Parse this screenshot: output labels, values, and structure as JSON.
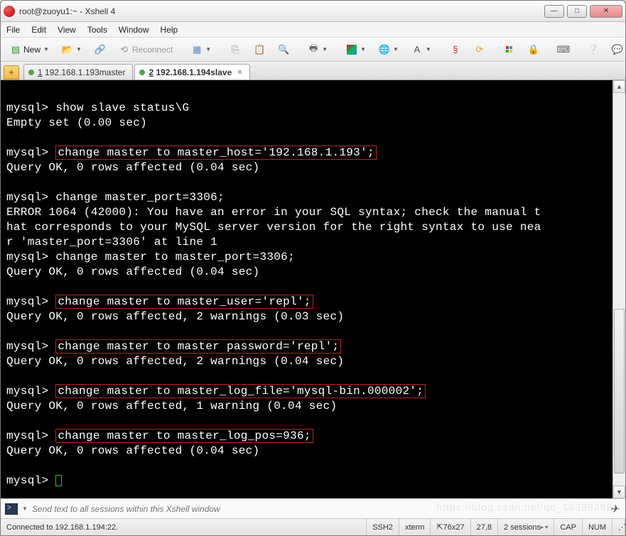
{
  "window": {
    "title": "root@zuoyu1:~ - Xshell 4"
  },
  "menu": {
    "file": "File",
    "edit": "Edit",
    "view": "View",
    "tools": "Tools",
    "window": "Window",
    "help": "Help"
  },
  "toolbar": {
    "new": "New",
    "reconnect": "Reconnect"
  },
  "tabs": {
    "t1": {
      "num": "1",
      "label": "192.168.1.193master"
    },
    "t2": {
      "num": "2",
      "label": "192.168.1.194slave"
    }
  },
  "terminal": {
    "p": "mysql> ",
    "l1": "show slave status\\G",
    "l2": "Empty set (0.00 sec)",
    "cmd_host": "change master to master_host='192.168.1.193';",
    "res_host": "Query OK, 0 rows affected (0.04 sec)",
    "cmd_port_bad": "change master_port=3306;",
    "err1": "ERROR 1064 (42000): You have an error in your SQL syntax; check the manual t",
    "err2": "hat corresponds to your MySQL server version for the right syntax to use nea",
    "err3": "r 'master_port=3306' at line 1",
    "cmd_port": "change master to master_port=3306;",
    "res_port": "Query OK, 0 rows affected (0.04 sec)",
    "cmd_user": "change master to master_user='repl';",
    "res_user": "Query OK, 0 rows affected, 2 warnings (0.03 sec)",
    "cmd_pass": "change master to master password='repl';",
    "res_pass": "Query OK, 0 rows affected, 2 warnings (0.04 sec)",
    "cmd_logf": "change master to master_log_file='mysql-bin.000002';",
    "res_logf": "Query OK, 0 rows affected, 1 warning (0.04 sec)",
    "cmd_logp": "change master to master_log_pos=936;",
    "res_logp": "Query OK, 0 rows affected (0.04 sec)"
  },
  "compose": {
    "placeholder": "Send text to all sessions within this Xshell window"
  },
  "status": {
    "conn": "Connected to 192.168.1.194:22.",
    "proto": "SSH2",
    "term": "xterm",
    "size": "76x27",
    "pos": "27,8",
    "sess": "2 sessions",
    "cap": "CAP",
    "num": "NUM"
  },
  "watermark": "https://blog.csdn.net/qq_16399389"
}
